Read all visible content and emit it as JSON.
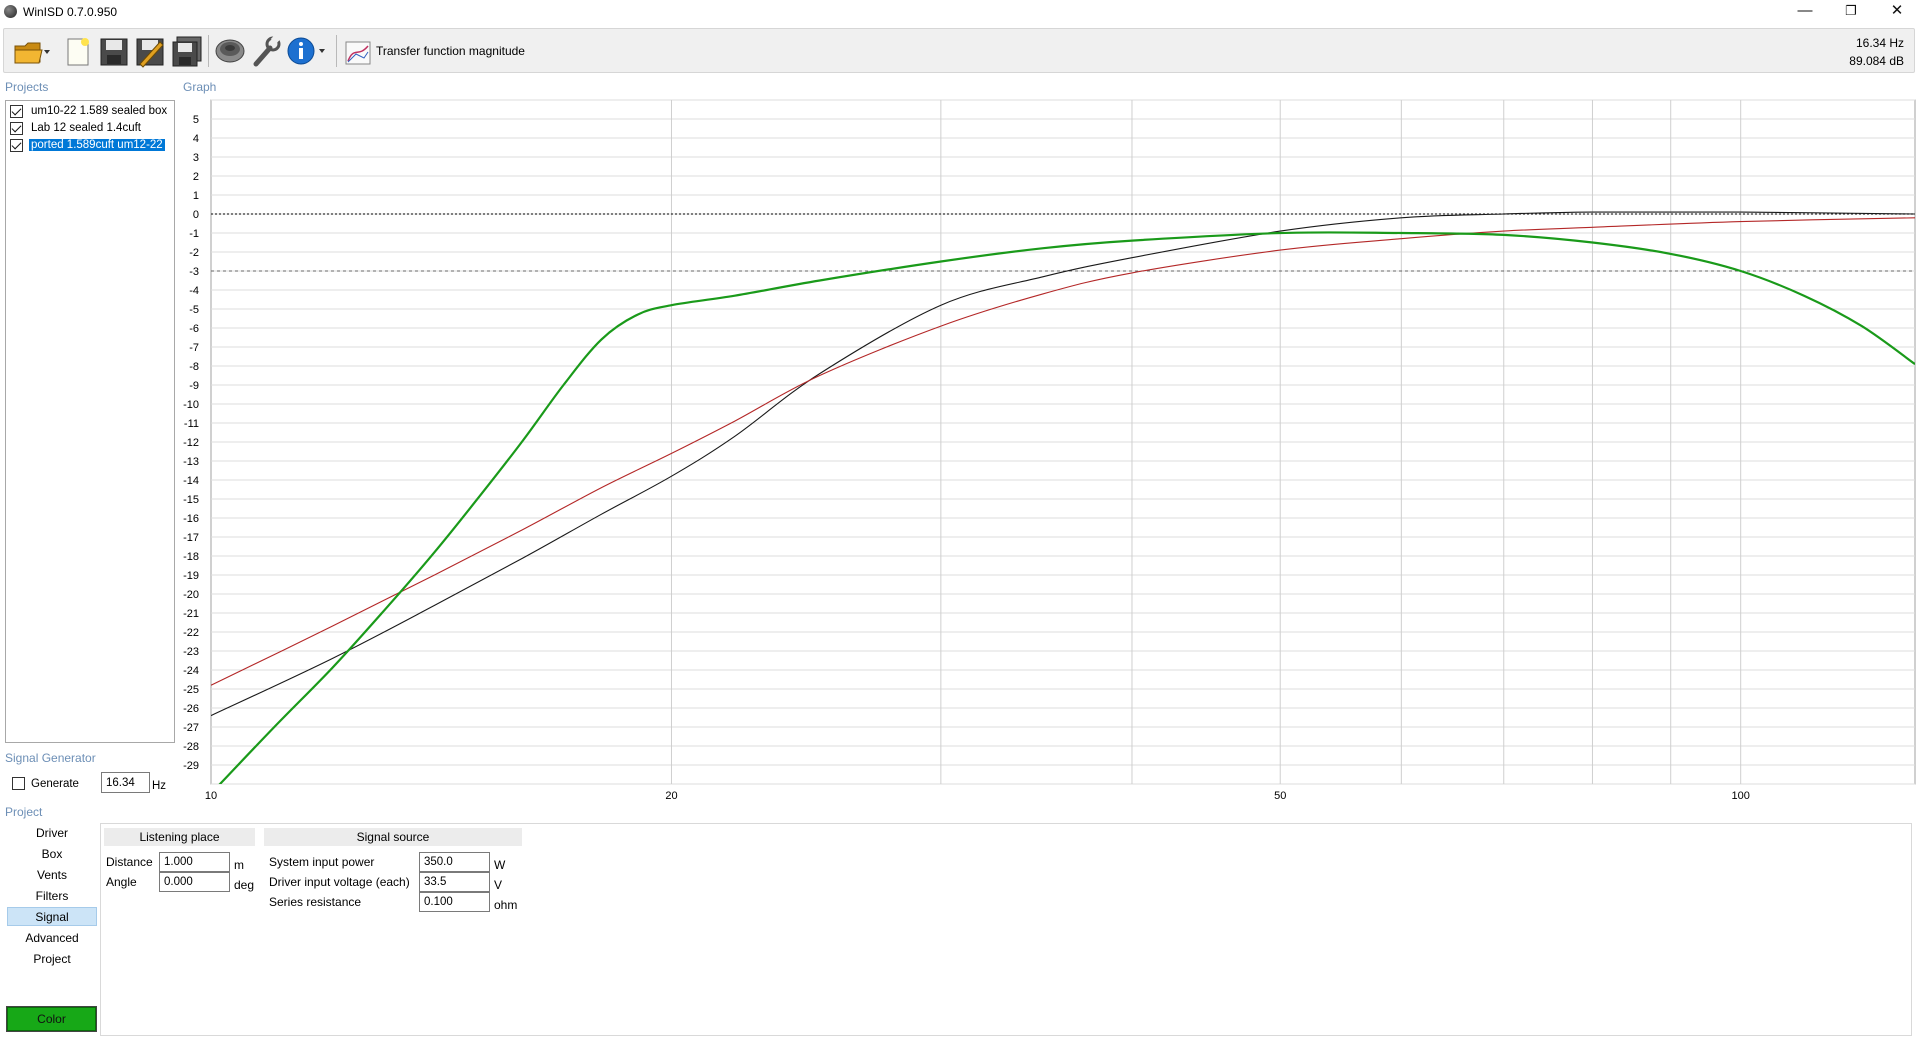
{
  "window": {
    "title": "WinISD 0.7.0.950",
    "minimize_glyph": "—",
    "restore_glyph": "❐",
    "close_glyph": "✕"
  },
  "toolbar": {
    "icons": [
      "open-folder-icon",
      "new-document-icon",
      "save-icon",
      "save-as-icon",
      "save-all-icon",
      "driver-icon",
      "wrench-icon",
      "info-icon",
      "graph-icon"
    ],
    "graph_label": "Transfer function magnitude",
    "readout_freq": "16.34 Hz",
    "readout_db": "89.084 dB"
  },
  "labels": {
    "projects": "Projects",
    "graph": "Graph",
    "signal_generator": "Signal Generator",
    "project": "Project"
  },
  "projects": [
    {
      "name": "um10-22 1.589 sealed box",
      "checked": true,
      "selected": false,
      "color": "#1a1a1a"
    },
    {
      "name": "Lab 12 sealed 1.4cuft",
      "checked": true,
      "selected": false,
      "color": "#b42828"
    },
    {
      "name": "ported 1.589cuft um12-22",
      "checked": true,
      "selected": true,
      "color": "#1a9a1a"
    }
  ],
  "signal_generator": {
    "generate_label": "Generate",
    "generate_checked": false,
    "frequency": "16.34",
    "unit": "Hz"
  },
  "project_nav": {
    "items": [
      "Driver",
      "Box",
      "Vents",
      "Filters",
      "Signal",
      "Advanced",
      "Project"
    ],
    "active": "Signal",
    "color_button": "Color",
    "color_value": "#17a817"
  },
  "listening_place": {
    "header": "Listening place",
    "distance_label": "Distance",
    "distance_value": "1.000",
    "distance_unit": "m",
    "angle_label": "Angle",
    "angle_value": "0.000",
    "angle_unit": "deg"
  },
  "signal_source": {
    "header": "Signal source",
    "power_label": "System input power",
    "power_value": "350.0",
    "power_unit": "W",
    "voltage_label": "Driver input voltage (each)",
    "voltage_value": "33.5",
    "voltage_unit": "V",
    "resistance_label": "Series resistance",
    "resistance_value": "0.100",
    "resistance_unit": "ohm"
  },
  "chart_data": {
    "type": "line",
    "title": "",
    "xlabel": "",
    "ylabel": "",
    "x_scale": "log",
    "xlim": [
      10,
      130
    ],
    "ylim": [
      -30,
      6
    ],
    "x_tick_labels": [
      10,
      20,
      50,
      100
    ],
    "x_grid": [
      20,
      30,
      40,
      50,
      60,
      70,
      80,
      90,
      100
    ],
    "y_ticks": [
      5,
      4,
      3,
      2,
      1,
      0,
      -1,
      -2,
      -3,
      -4,
      -5,
      -6,
      -7,
      -8,
      -9,
      -10,
      -11,
      -12,
      -13,
      -14,
      -15,
      -16,
      -17,
      -18,
      -19,
      -20,
      -21,
      -22,
      -23,
      -24,
      -25,
      -26,
      -27,
      -28,
      -29
    ],
    "reference_lines": [
      0,
      -3
    ],
    "grid": true,
    "series": [
      {
        "name": "um10-22 1.589 sealed box",
        "color": "#1a1a1a",
        "x": [
          10,
          12,
          14,
          16,
          18,
          20,
          22,
          25,
          30,
          35,
          40,
          50,
          60,
          70,
          80,
          100,
          130
        ],
        "y": [
          -26.4,
          -23.4,
          -20.6,
          -18.1,
          -15.8,
          -13.8,
          -11.7,
          -8.4,
          -4.8,
          -3.3,
          -2.3,
          -0.9,
          -0.2,
          0.0,
          0.1,
          0.1,
          0.0
        ]
      },
      {
        "name": "Lab 12 sealed 1.4cuft",
        "color": "#b42828",
        "x": [
          10,
          12,
          14,
          16,
          18,
          20,
          22,
          25,
          30,
          35,
          40,
          50,
          60,
          70,
          80,
          100,
          130
        ],
        "y": [
          -24.8,
          -21.7,
          -19.0,
          -16.6,
          -14.4,
          -12.6,
          -10.9,
          -8.5,
          -5.9,
          -4.2,
          -3.1,
          -1.9,
          -1.3,
          -0.9,
          -0.7,
          -0.4,
          -0.2
        ]
      },
      {
        "name": "ported 1.589cuft um12-22",
        "color": "#1a9a1a",
        "x": [
          10,
          11,
          12,
          13,
          14,
          15,
          16,
          17,
          18,
          19,
          20,
          22,
          25,
          30,
          35,
          40,
          50,
          60,
          70,
          80,
          90,
          100,
          110,
          120,
          130
        ],
        "y": [
          -30.5,
          -27.0,
          -23.9,
          -20.8,
          -17.8,
          -14.8,
          -11.9,
          -9.0,
          -6.6,
          -5.3,
          -4.8,
          -4.3,
          -3.5,
          -2.5,
          -1.8,
          -1.4,
          -1.0,
          -1.0,
          -1.1,
          -1.5,
          -2.1,
          -3.0,
          -4.3,
          -5.9,
          -7.9
        ]
      }
    ]
  }
}
